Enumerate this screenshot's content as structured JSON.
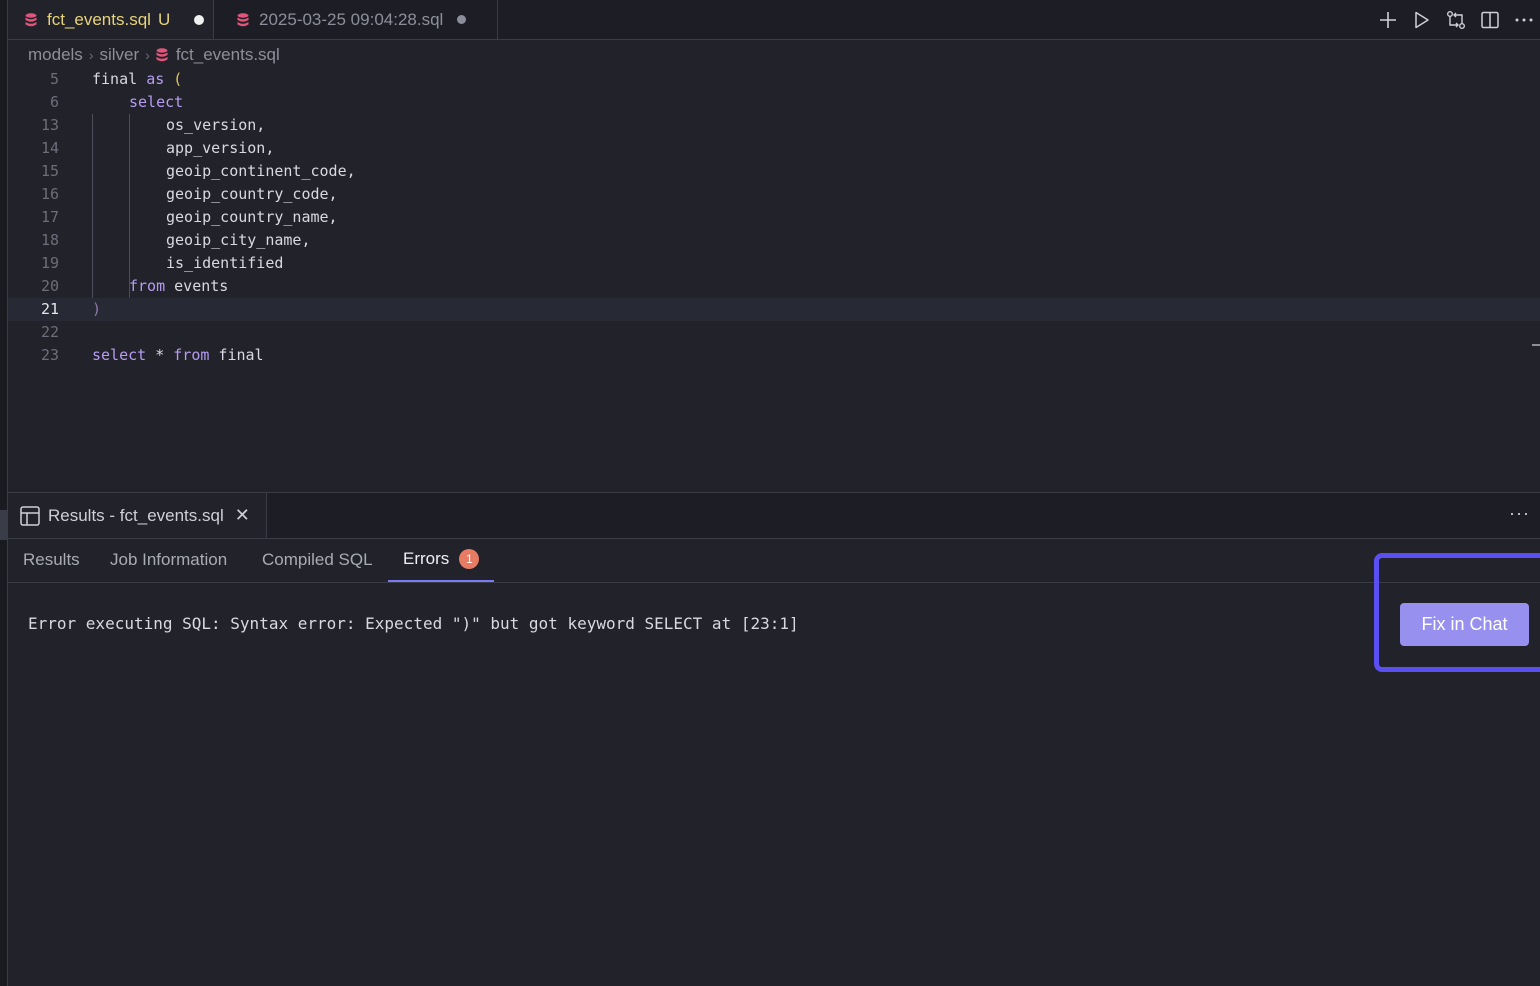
{
  "tabs": [
    {
      "name": "fct_events.sql",
      "modified_flag": "U",
      "icon": "database-icon"
    },
    {
      "name": "2025-03-25 09:04:28.sql",
      "icon": "database-icon"
    }
  ],
  "tab_actions": [
    "plus-icon",
    "run-icon",
    "compare-changes-icon",
    "split-editor-icon",
    "more-icon"
  ],
  "breadcrumb": [
    "models",
    "silver",
    "fct_events.sql"
  ],
  "code_lines": [
    {
      "num": "5",
      "text": "final as ("
    },
    {
      "num": "6",
      "text": "select"
    },
    {
      "num": "13",
      "text": "os_version,"
    },
    {
      "num": "14",
      "text": "app_version,"
    },
    {
      "num": "15",
      "text": "geoip_continent_code,"
    },
    {
      "num": "16",
      "text": "geoip_country_code,"
    },
    {
      "num": "17",
      "text": "geoip_country_name,"
    },
    {
      "num": "18",
      "text": "geoip_city_name,"
    },
    {
      "num": "19",
      "text": "is_identified"
    },
    {
      "num": "20",
      "text": "from events"
    },
    {
      "num": "21",
      "text": ")"
    },
    {
      "num": "22",
      "text": ""
    },
    {
      "num": "23",
      "text": "select * from final"
    }
  ],
  "current_line": "21",
  "panel": {
    "tab_title": "Results - fct_events.sql",
    "more": "···",
    "subtabs": [
      "Results",
      "Job Information",
      "Compiled SQL",
      "Errors"
    ],
    "active_subtab": "Errors",
    "error_count": "1",
    "error_message": "Error executing SQL: Syntax error: Expected \")\" but got keyword SELECT at [23:1]",
    "fix_button": "Fix in Chat"
  },
  "colors": {
    "accent": "#7c7cf2",
    "highlight": "#5a4ff0",
    "button": "#9890ee",
    "badge": "#e77b63",
    "modified": "#e6d37a"
  }
}
